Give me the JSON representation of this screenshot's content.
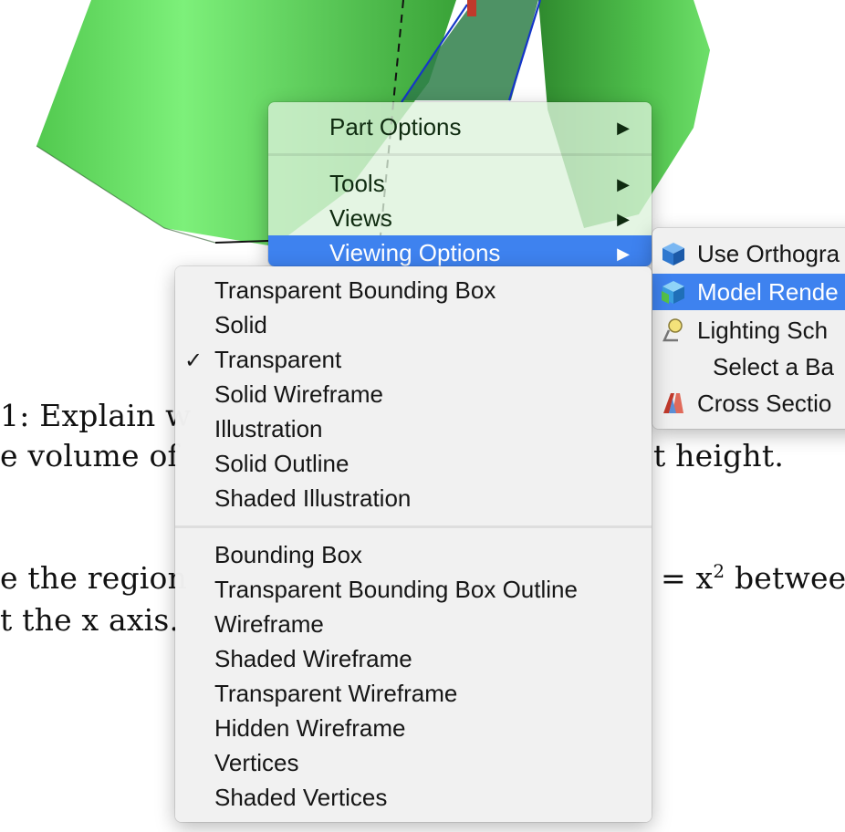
{
  "document": {
    "line1_prefix": "1: Explain w",
    "line1_suffix": "",
    "line2_prefix": "e volume of",
    "line2_suffix": "t height.",
    "line3_prefix": "e the region",
    "line3_suffix_eq": "= x",
    "line3_suffix_exp": "2",
    "line3_suffix_tail": " betwee",
    "line4_prefix": "t the x axis."
  },
  "main_menu": {
    "items": [
      {
        "label": "Part Options",
        "submenu": "▶"
      },
      {
        "label": "Tools",
        "submenu": "▶"
      },
      {
        "label": "Views",
        "submenu": "▶"
      },
      {
        "label": "Viewing Options",
        "submenu": "▶",
        "highlighted": true
      }
    ]
  },
  "render_menu": {
    "checkmark": "✓",
    "group1": [
      {
        "label": "Transparent Bounding Box"
      },
      {
        "label": "Solid"
      },
      {
        "label": "Transparent",
        "checked": true
      },
      {
        "label": "Solid Wireframe"
      },
      {
        "label": "Illustration"
      },
      {
        "label": "Solid Outline"
      },
      {
        "label": "Shaded Illustration"
      }
    ],
    "group2": [
      {
        "label": "Bounding Box"
      },
      {
        "label": "Transparent Bounding Box Outline"
      },
      {
        "label": "Wireframe"
      },
      {
        "label": "Shaded Wireframe"
      },
      {
        "label": "Transparent Wireframe"
      },
      {
        "label": "Hidden Wireframe"
      },
      {
        "label": "Vertices"
      },
      {
        "label": "Shaded Vertices"
      }
    ]
  },
  "viewing_submenu": {
    "items": [
      {
        "label": "Use Orthogra",
        "icon": "cube-icon"
      },
      {
        "label": "Model Rende",
        "icon": "cube-render-icon",
        "highlighted": true
      },
      {
        "label": "Lighting Sch",
        "icon": "lamp-icon"
      },
      {
        "label": "Select a Ba",
        "icon": ""
      },
      {
        "label": "Cross Sectio",
        "icon": "cross-section-icon"
      }
    ]
  },
  "colors": {
    "highlight": "#3e82ef",
    "shape_green": "#5fd65c",
    "menu_text": "#161616"
  }
}
